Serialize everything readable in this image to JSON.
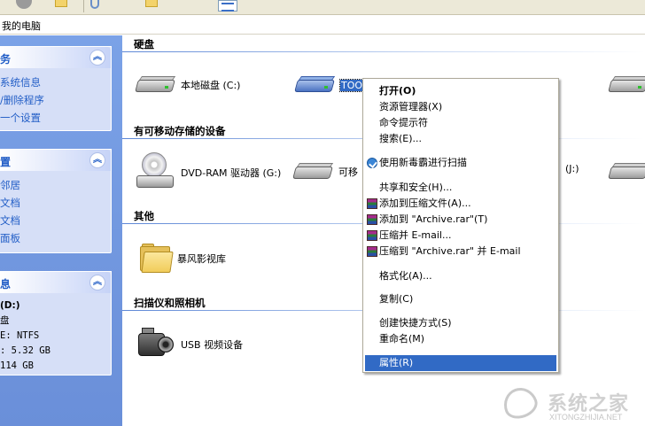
{
  "address": {
    "path": "我的电脑"
  },
  "left_pane": {
    "system_tasks": {
      "title": "务",
      "items": [
        "系统信息",
        "/删除程序",
        "一个设置"
      ]
    },
    "other_places": {
      "title": "置",
      "items": [
        "邻居",
        "文档",
        "文档",
        "面板"
      ]
    },
    "details": {
      "title": "息",
      "lines": [
        "(D:)",
        "盘",
        "E: NTFS",
        ": 5.32 GB",
        "114 GB"
      ]
    }
  },
  "groups": {
    "hard_drives": "硬盘",
    "removable": "有可移动存储的设备",
    "other": "其他",
    "scanners": "扫描仪和照相机"
  },
  "items": {
    "local_c": "本地磁盘 (C:)",
    "tools": "TOOl",
    "dvd": "DVD-RAM 驱动器 (G:)",
    "removable": "可移",
    "j_partial": "(J:)",
    "video_lib": "暴风影视库",
    "usb_cam": "USB 视频设备"
  },
  "context_menu": {
    "open": "打开(O)",
    "explorer": "资源管理器(X)",
    "cmd": "命令提示符",
    "search": "搜索(E)...",
    "scan": "使用新毒霸进行扫描",
    "share": "共享和安全(H)...",
    "add_archive": "添加到压缩文件(A)...",
    "add_rar": "添加到 \"Archive.rar\"(T)",
    "compress_email": "压缩并 E-mail...",
    "compress_rar_email": "压缩到 \"Archive.rar\" 并 E-mail",
    "format": "格式化(A)...",
    "copy": "复制(C)",
    "shortcut": "创建快捷方式(S)",
    "rename": "重命名(M)",
    "properties": "属性(R)"
  },
  "watermark": {
    "text": "系统之家",
    "url": "XITONGZHIJIA.NET"
  },
  "colors": {
    "selection": "#316ac5",
    "taskpane": "#7ba2e7",
    "link": "#215dc6"
  }
}
